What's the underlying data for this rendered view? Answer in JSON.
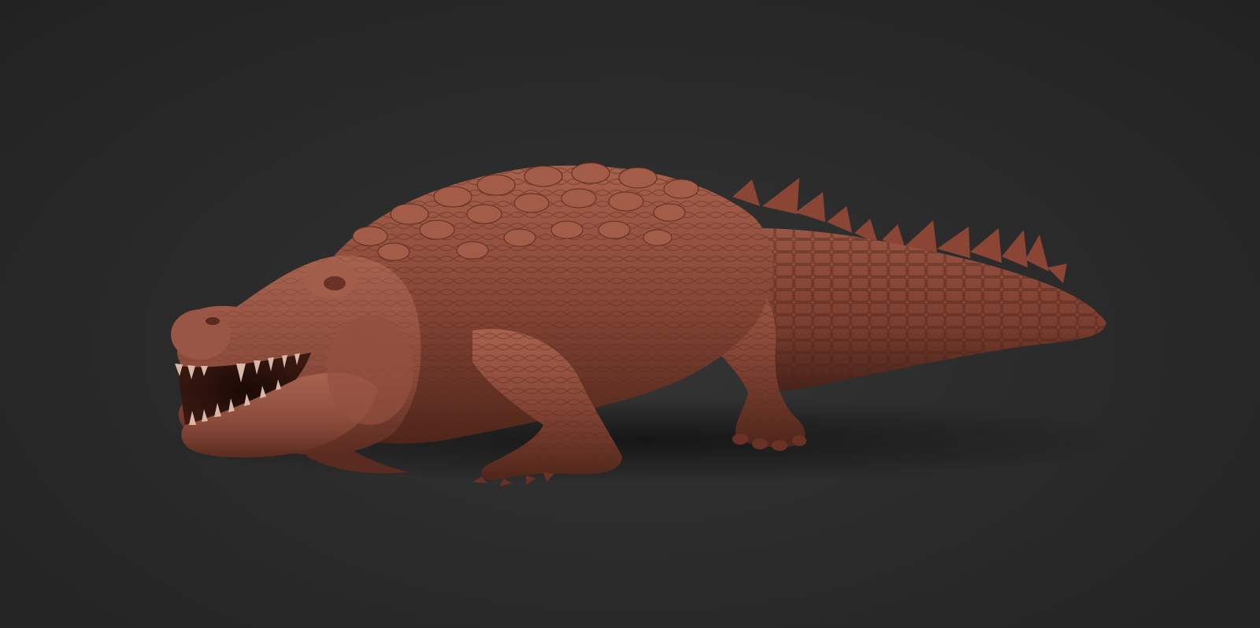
{
  "scene": {
    "background_color": "#2b2b2b",
    "subject": "crocodile-sculpt",
    "material_color": "#8a4a3a",
    "material_shadow": "#4a2219",
    "material_highlight": "#b06a55"
  }
}
